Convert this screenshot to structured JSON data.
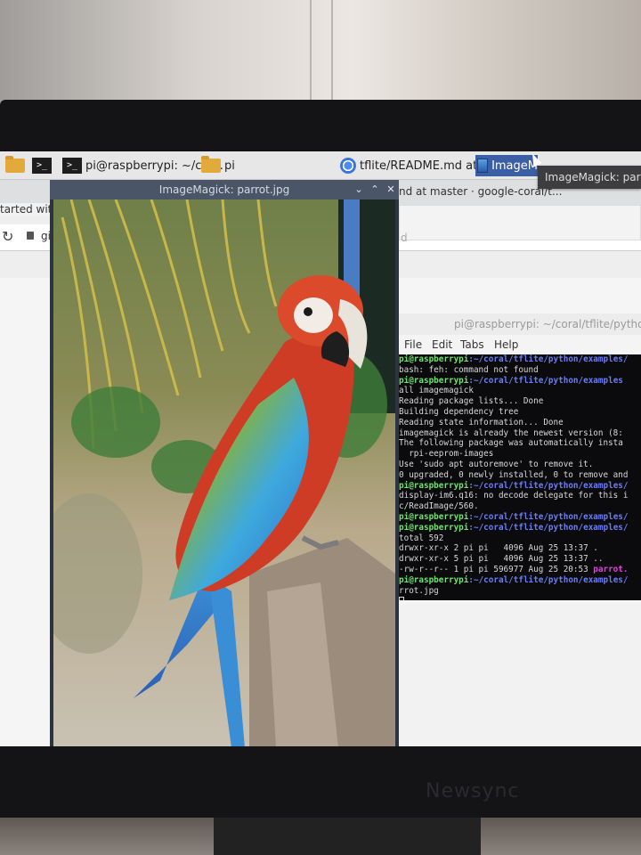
{
  "taskbar": {
    "items": [
      {
        "label": "",
        "icon": "folder-icon"
      },
      {
        "label": "",
        "icon": "terminal-icon"
      },
      {
        "label": "pi@raspberrypi: ~/cor...",
        "icon": "terminal-icon"
      },
      {
        "label": "pi",
        "icon": "folder-icon"
      },
      {
        "label": "tflite/README.md at ...",
        "icon": "chrome-icon"
      },
      {
        "label": "ImageM",
        "icon": "image-icon"
      }
    ],
    "tooltip": "ImageMagick: parrot"
  },
  "browser": {
    "tab_text": "nd at master · google-coral/t...",
    "left_fragment": "tarted with",
    "url_fragment": "gi",
    "right_gray": "d"
  },
  "image_window": {
    "title": "ImageMagick: parrot.jpg",
    "buttons": {
      "minimize": "⌄",
      "maximize": "⌃",
      "close": "✕"
    }
  },
  "terminal": {
    "title": "pi@raspberrypi: ~/coral/tflite/python/e",
    "menu": [
      "File",
      "Edit",
      "Tabs",
      "Help"
    ],
    "prompt_user": "pi@raspberrypi",
    "prompt_path": ":~/coral/tflite/python/examples",
    "prompt_path_long": ":~/coral/tflite/python/examples/",
    "lines": {
      "l2": "bash: feh: command not found",
      "l4": "all imagemagick",
      "l5": "Reading package lists... Done",
      "l6": "Building dependency tree",
      "l7": "Reading state information... Done",
      "l8": "imagemagick is already the newest version (8:",
      "l9": "The following package was automatically insta",
      "l10": "  rpi-eeprom-images",
      "l11": "Use 'sudo apt autoremove' to remove it.",
      "l12": "0 upgraded, 0 newly installed, 0 to remove and",
      "l14": "display-im6.q16: no decode delegate for this i",
      "l15": "c/ReadImage/560.",
      "l18": "total 592",
      "l19": "drwxr-xr-x 2 pi pi   4096 Aug 25 13:37 .",
      "l20": "drwxr-xr-x 5 pi pi   4096 Aug 25 13:37 ..",
      "l21_prefix": "-rw-r--r-- 1 pi pi 596977 Aug 25 20:53 ",
      "l21_file": "parrot.",
      "l23": "rrot.jpg"
    }
  },
  "monitor": {
    "brand": "Newsync"
  }
}
